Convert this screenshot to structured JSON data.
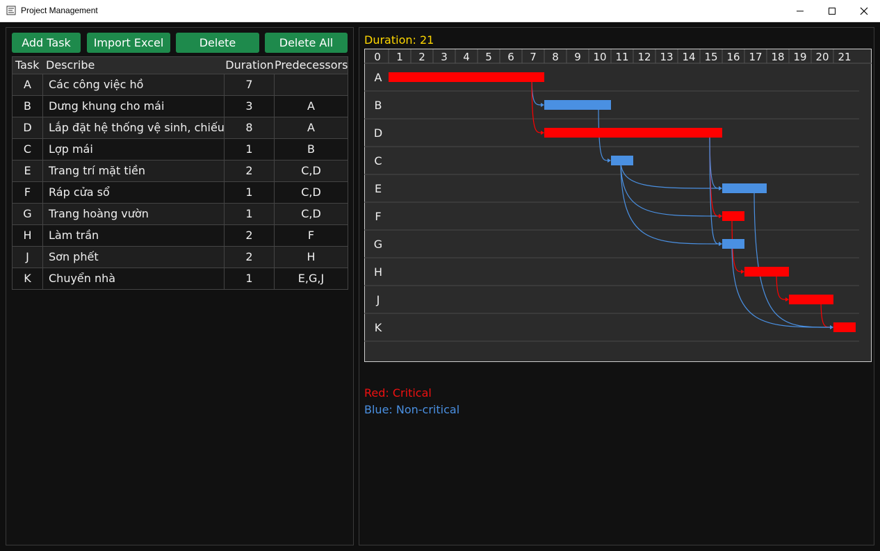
{
  "window": {
    "title": "Project Management",
    "controls": [
      "minimize",
      "maximize",
      "close"
    ]
  },
  "toolbar": {
    "add_task": "Add Task",
    "import_excel": "Import Excel",
    "delete": "Delete",
    "delete_all": "Delete All"
  },
  "task_table": {
    "headers": [
      "Task",
      "Describe",
      "Duration",
      "Predecessors"
    ],
    "rows": [
      {
        "task": "A",
        "describe": "Các công việc hồ",
        "duration": "7",
        "predecessors": ""
      },
      {
        "task": "B",
        "describe": "Dưng khung cho mái",
        "duration": "3",
        "predecessors": "A"
      },
      {
        "task": "D",
        "describe": "Lắp đặt hệ thống vệ sinh, chiếu sá",
        "duration": "8",
        "predecessors": "A"
      },
      {
        "task": "C",
        "describe": "Lợp mái",
        "duration": "1",
        "predecessors": "B"
      },
      {
        "task": "E",
        "describe": "Trang trí mặt tiền",
        "duration": "2",
        "predecessors": "C,D"
      },
      {
        "task": "F",
        "describe": "Ráp cửa sổ",
        "duration": "1",
        "predecessors": "C,D"
      },
      {
        "task": "G",
        "describe": "Trang hoàng vườn",
        "duration": "1",
        "predecessors": "C,D"
      },
      {
        "task": "H",
        "describe": "Làm trần",
        "duration": "2",
        "predecessors": "F"
      },
      {
        "task": "J",
        "describe": "Sơn phết",
        "duration": "2",
        "predecessors": "H"
      },
      {
        "task": "K",
        "describe": "Chuyển nhà",
        "duration": "1",
        "predecessors": "E,G,J"
      }
    ]
  },
  "gantt": {
    "duration_label": "Duration: 21",
    "time_ticks": [
      "0",
      "1",
      "2",
      "3",
      "4",
      "5",
      "6",
      "7",
      "8",
      "9",
      "10",
      "11",
      "12",
      "13",
      "14",
      "15",
      "16",
      "17",
      "18",
      "19",
      "20",
      "21"
    ],
    "tasks": [
      {
        "name": "A",
        "start": 0,
        "end": 7,
        "critical": true
      },
      {
        "name": "B",
        "start": 7,
        "end": 10,
        "critical": false
      },
      {
        "name": "D",
        "start": 7,
        "end": 15,
        "critical": true
      },
      {
        "name": "C",
        "start": 10,
        "end": 11,
        "critical": false
      },
      {
        "name": "E",
        "start": 15,
        "end": 17,
        "critical": false
      },
      {
        "name": "F",
        "start": 15,
        "end": 16,
        "critical": true
      },
      {
        "name": "G",
        "start": 15,
        "end": 16,
        "critical": false
      },
      {
        "name": "H",
        "start": 16,
        "end": 18,
        "critical": true
      },
      {
        "name": "J",
        "start": 18,
        "end": 20,
        "critical": true
      },
      {
        "name": "K",
        "start": 20,
        "end": 21,
        "critical": true
      }
    ],
    "dependencies": [
      {
        "from": "A",
        "to": "B",
        "critical": false
      },
      {
        "from": "A",
        "to": "D",
        "critical": true
      },
      {
        "from": "B",
        "to": "C",
        "critical": false
      },
      {
        "from": "C",
        "to": "E",
        "critical": false
      },
      {
        "from": "C",
        "to": "F",
        "critical": false
      },
      {
        "from": "C",
        "to": "G",
        "critical": false
      },
      {
        "from": "D",
        "to": "E",
        "critical": false
      },
      {
        "from": "D",
        "to": "F",
        "critical": true
      },
      {
        "from": "D",
        "to": "G",
        "critical": false
      },
      {
        "from": "F",
        "to": "H",
        "critical": true
      },
      {
        "from": "H",
        "to": "J",
        "critical": true
      },
      {
        "from": "J",
        "to": "K",
        "critical": true
      },
      {
        "from": "E",
        "to": "K",
        "critical": false
      },
      {
        "from": "G",
        "to": "K",
        "critical": false
      }
    ]
  },
  "legend": {
    "critical": "Red: Critical",
    "non_critical": "Blue: Non-critical"
  },
  "colors": {
    "critical": "#ff0000",
    "non_critical": "#4a90e2",
    "button": "#1e8a4c",
    "duration_text": "#ffd700"
  }
}
